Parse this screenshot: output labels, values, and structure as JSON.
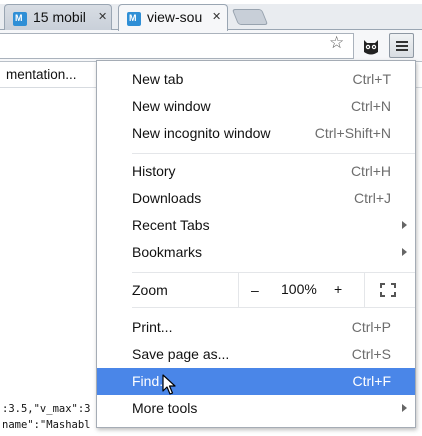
{
  "tabs": [
    {
      "title": "15 mobil",
      "active": false
    },
    {
      "title": "view-sou",
      "active": true
    }
  ],
  "tab_close_glyph": "✕",
  "toolbar": {
    "bookmark_star_icon": "star-icon",
    "extension_icon": "owl-icon",
    "menu_icon": "hamburger-menu-icon"
  },
  "page": {
    "bookmark_text": "mentation...",
    "code_lines": [
      ":3.5,\"v_max\":3",
      "name\":\"Mashabl"
    ]
  },
  "menu": {
    "items": [
      {
        "label": "New tab",
        "shortcut": "Ctrl+T"
      },
      {
        "label": "New window",
        "shortcut": "Ctrl+N"
      },
      {
        "label": "New incognito window",
        "shortcut": "Ctrl+Shift+N"
      },
      {
        "label": "History",
        "shortcut": "Ctrl+H"
      },
      {
        "label": "Downloads",
        "shortcut": "Ctrl+J"
      },
      {
        "label": "Recent Tabs",
        "shortcut": ""
      },
      {
        "label": "Bookmarks",
        "shortcut": ""
      },
      {
        "label": "Print...",
        "shortcut": "Ctrl+P"
      },
      {
        "label": "Save page as...",
        "shortcut": "Ctrl+S"
      },
      {
        "label": "Find...",
        "shortcut": "Ctrl+F",
        "highlighted": true
      },
      {
        "label": "More tools",
        "shortcut": ""
      }
    ],
    "zoom": {
      "label": "Zoom",
      "minus": "–",
      "value": "100%",
      "plus": "+"
    }
  },
  "colors": {
    "highlight": "#4a86e8",
    "favicon": "#2f8fd6"
  }
}
